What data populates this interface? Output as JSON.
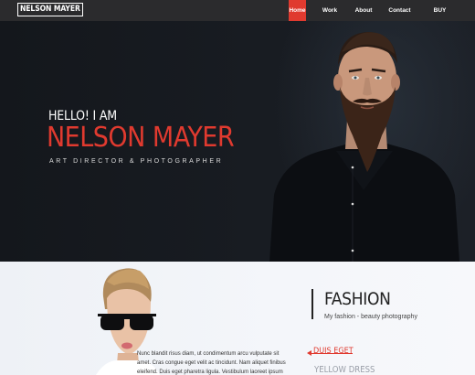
{
  "brand": {
    "label": "NELSON MAYER"
  },
  "nav": {
    "items": [
      {
        "label": "Home",
        "active": true
      },
      {
        "label": "Work"
      },
      {
        "label": "About"
      },
      {
        "label": "Contact"
      },
      {
        "label": "BUY NOW!"
      }
    ]
  },
  "hero": {
    "greeting": "HELLO! I AM",
    "name": "NELSON MAYER",
    "role": "ART DIRECTOR & PHOTOGRAPHER"
  },
  "portfolio": {
    "lorem_lines": [
      "Nunc blandit risus diam, ut condimentum arcu vulputate sit",
      "amet. Cras congue eget velit ac tincidunt. Nam aliquet finibus",
      "eleifend. Duis eget pharetra ligula. Vestibulum laoreet ipsum"
    ],
    "category_title": "FASHION",
    "category_subtitle": "My fashion - beauty photography",
    "items": [
      {
        "label": "DUIS EGET"
      },
      {
        "label": "YELLOW DRESS"
      }
    ]
  },
  "colors": {
    "accent": "#e03a2f",
    "navbar": "#2b2b2d",
    "hero_bg": "#171b21"
  }
}
